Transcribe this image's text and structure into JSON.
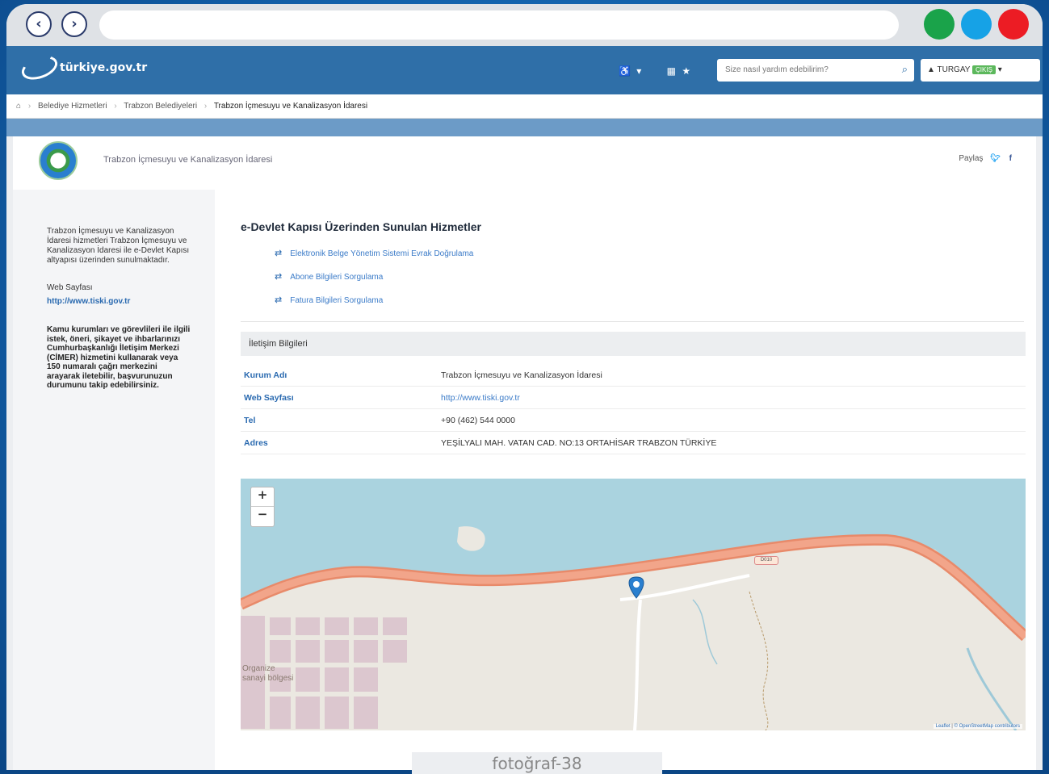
{
  "browser": {
    "back_icon": "‹",
    "forward_icon": "›",
    "dot_colors": [
      "#1aa34a",
      "#16a2e6",
      "#ec1c24"
    ]
  },
  "header": {
    "logo_text": "türkiye.gov.tr",
    "search_placeholder": "Size nasıl yardım edebilirim?",
    "user_name": "TURGAY",
    "user_exit": "ÇIKIŞ"
  },
  "breadcrumb": {
    "items": [
      "Belediye Hizmetleri",
      "Trabzon Belediyeleri",
      "Trabzon İçmesuyu ve Kanalizasyon İdaresi"
    ]
  },
  "institution": {
    "title": "Trabzon İçmesuyu ve Kanalizasyon İdaresi",
    "share_label": "Paylaş"
  },
  "sidebar": {
    "description": "Trabzon İçmesuyu ve Kanalizasyon İdaresi hizmetleri Trabzon İçmesuyu ve Kanalizasyon İdaresi ile e-Devlet Kapısı altyapısı üzerinden sunulmaktadır.",
    "web_label": "Web Sayfası",
    "web_link": "http://www.tiski.gov.tr",
    "cimer_text": "Kamu kurumları ve görevlileri ile ilgili istek, öneri, şikayet ve ihbarlarınızı Cumhurbaşkanlığı İletişim Merkezi (CİMER) hizmetini kullanarak veya 150 numaralı çağrı merkezini arayarak iletebilir, başvurunuzun durumunu takip edebilirsiniz."
  },
  "services": {
    "title": "e-Devlet Kapısı Üzerinden Sunulan Hizmetler",
    "items": [
      "Elektronik Belge Yönetim Sistemi Evrak Doğrulama",
      "Abone Bilgileri Sorgulama",
      "Fatura Bilgileri Sorgulama"
    ]
  },
  "contact": {
    "heading": "İletişim Bilgileri",
    "rows": [
      {
        "key": "Kurum Adı",
        "value": "Trabzon İçmesuyu ve Kanalizasyon İdaresi"
      },
      {
        "key": "Web Sayfası",
        "value": "http://www.tiski.gov.tr"
      },
      {
        "key": "Tel",
        "value": "+90 (462) 544 0000"
      },
      {
        "key": "Adres",
        "value": "YEŞİLYALI MAH. VATAN CAD. NO:13 ORTAHİSAR TRABZON TÜRKİYE"
      }
    ]
  },
  "map": {
    "zoom_in": "+",
    "zoom_out": "−",
    "zone_label": "Organize sanayi bölgesi",
    "road_badge": "D010",
    "attribution_leaflet": "Leaflet",
    "attribution_osm": "© OpenStreetMap contributors"
  },
  "caption": "fotoğraf-38"
}
